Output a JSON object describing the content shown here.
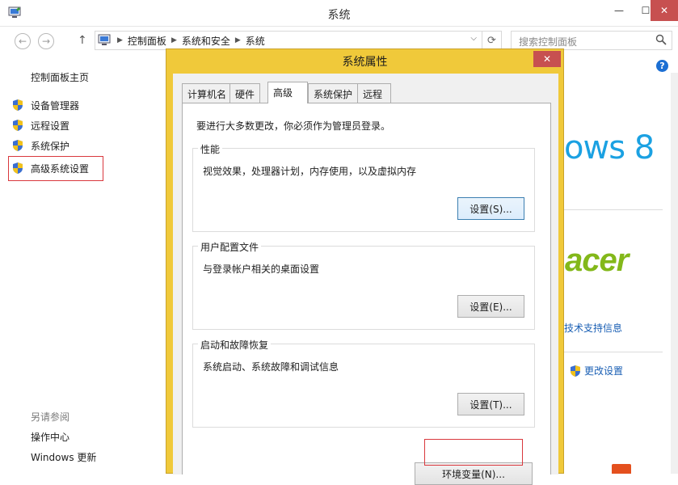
{
  "window": {
    "title": "系统",
    "minimize": "—",
    "maximize": "☐",
    "close": "✕"
  },
  "nav": {
    "back": "←",
    "forward": "→",
    "up": "↑",
    "breadcrumbs": [
      "控制面板",
      "系统和安全",
      "系统"
    ],
    "refresh": "⟳",
    "search_placeholder": "搜索控制面板"
  },
  "sidebar": {
    "home": "控制面板主页",
    "items": [
      {
        "label": "设备管理器",
        "icon": "uac-shield-icon"
      },
      {
        "label": "远程设置",
        "icon": "uac-shield-icon"
      },
      {
        "label": "系统保护",
        "icon": "uac-shield-icon"
      },
      {
        "label": "高级系统设置",
        "icon": "uac-shield-icon"
      }
    ],
    "see_also": "另请参阅",
    "links": [
      "操作中心",
      "Windows 更新"
    ]
  },
  "right_pane": {
    "windows_text": "ows 8",
    "brand_text": "acer",
    "support_link": "技术支持信息",
    "change_settings": "更改设置",
    "help": "?"
  },
  "dialog": {
    "title": "系统属性",
    "close": "✕",
    "tabs": [
      "计算机名",
      "硬件",
      "高级",
      "系统保护",
      "远程"
    ],
    "active_tab": "高级",
    "admin_note": "要进行大多数更改，你必须作为管理员登录。",
    "groups": [
      {
        "title": "性能",
        "desc": "视觉效果，处理器计划，内存使用，以及虚拟内存",
        "button": "设置(S)..."
      },
      {
        "title": "用户配置文件",
        "desc": "与登录帐户相关的桌面设置",
        "button": "设置(E)..."
      },
      {
        "title": "启动和故障恢复",
        "desc": "系统启动、系统故障和调试信息",
        "button": "设置(T)..."
      }
    ],
    "env_button": "环境变量(N)..."
  },
  "colors": {
    "dialog_frame": "#f0c93a",
    "close_red": "#c75050",
    "highlight_red": "#d9383d",
    "link_blue": "#1a5fb4",
    "win8_blue": "#1ba1e2",
    "acer_green": "#83b81a"
  }
}
